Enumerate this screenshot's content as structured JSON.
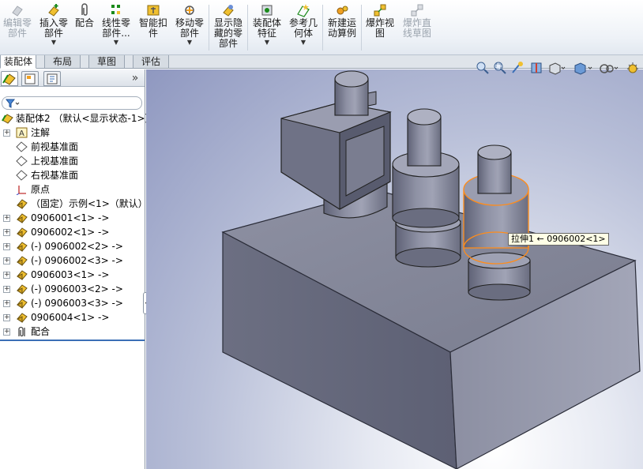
{
  "ribbon": {
    "edit_part": [
      "编辑零",
      "部件"
    ],
    "insert_part": [
      "插入零",
      "部件"
    ],
    "mate": "配合",
    "linear_pattern": [
      "线性零",
      "部件..."
    ],
    "smart_fasteners": [
      "智能扣",
      "件"
    ],
    "move_component": [
      "移动零",
      "部件"
    ],
    "show_hidden": [
      "显示隐",
      "藏的零",
      "部件"
    ],
    "assembly_features": [
      "装配体",
      "特征"
    ],
    "reference_geometry": [
      "参考几",
      "何体"
    ],
    "new_motion_study": [
      "新建运",
      "动算例"
    ],
    "exploded_view": [
      "爆炸视",
      "图"
    ],
    "explode_line_sketch": [
      "爆炸直",
      "线草图"
    ]
  },
  "tabs": [
    "装配体",
    "布局",
    "草图",
    "评估"
  ],
  "panel": {
    "more": "»",
    "tree": [
      {
        "label": "装配体2  （默认<显示状态-1>）",
        "icon": "assembly-icon",
        "level": 0,
        "expander": false
      },
      {
        "label": "注解",
        "icon": "annotation-icon",
        "level": 1,
        "expander": true
      },
      {
        "label": "前视基准面",
        "icon": "plane-icon",
        "level": 1,
        "expander": false
      },
      {
        "label": "上视基准面",
        "icon": "plane-icon",
        "level": 1,
        "expander": false
      },
      {
        "label": "右视基准面",
        "icon": "plane-icon",
        "level": 1,
        "expander": false
      },
      {
        "label": "原点",
        "icon": "origin-icon",
        "level": 1,
        "expander": false
      },
      {
        "label": "（固定）示例<1>（默认）",
        "icon": "part-icon",
        "level": 1,
        "expander": false
      },
      {
        "label": "0906001<1> ->",
        "icon": "part-icon",
        "level": 1,
        "expander": true
      },
      {
        "label": "0906002<1> ->",
        "icon": "part-icon",
        "level": 1,
        "expander": true
      },
      {
        "label": "(-) 0906002<2> ->",
        "icon": "part-icon",
        "level": 1,
        "expander": true
      },
      {
        "label": "(-) 0906002<3> ->",
        "icon": "part-icon",
        "level": 1,
        "expander": true
      },
      {
        "label": "0906003<1> ->",
        "icon": "part-icon",
        "level": 1,
        "expander": true
      },
      {
        "label": "(-) 0906003<2> ->",
        "icon": "part-icon",
        "level": 1,
        "expander": true
      },
      {
        "label": "(-) 0906003<3> ->",
        "icon": "part-icon",
        "level": 1,
        "expander": true
      },
      {
        "label": "0906004<1> ->",
        "icon": "part-icon",
        "level": 1,
        "expander": true
      },
      {
        "label": "配合",
        "icon": "mates-icon",
        "level": 1,
        "expander": true
      }
    ]
  },
  "viewport": {
    "tooltip": "拉伸1 ← 0906002<1>"
  },
  "colors": {
    "selection": "#ff8c1a",
    "part_fill": "#7e8192",
    "accent": "#3b6fb6"
  }
}
